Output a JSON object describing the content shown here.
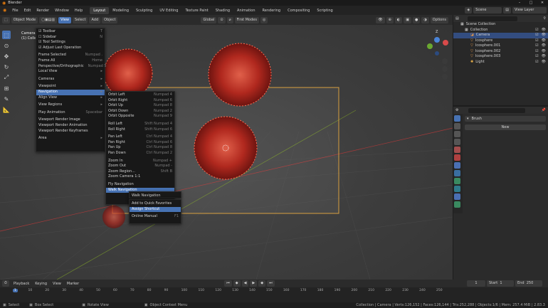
{
  "app": {
    "title": "Blender"
  },
  "menubar": {
    "items": [
      "File",
      "Edit",
      "Render",
      "Window",
      "Help"
    ],
    "workspaces": [
      "Layout",
      "Modeling",
      "Sculpting",
      "UV Editing",
      "Texture Paint",
      "Shading",
      "Animation",
      "Rendering",
      "Compositing",
      "Scripting"
    ],
    "active_workspace": "Layout",
    "scene": "Scene",
    "view_layer": "View Layer"
  },
  "header3d": {
    "mode": "Object Mode",
    "menus": [
      "View",
      "Select",
      "Add",
      "Object"
    ],
    "transform": "Global",
    "snap": "First Modes",
    "options": "Options"
  },
  "viewport": {
    "camera_label": "Camera P",
    "collection_label": "(1) Colle"
  },
  "view_menu": {
    "items": [
      {
        "label": "Toolbar",
        "shortcut": "T",
        "check": true
      },
      {
        "label": "Sidebar",
        "shortcut": "N",
        "check": false
      },
      {
        "label": "Tool Settings",
        "shortcut": "",
        "check": true
      },
      {
        "label": "Adjust Last Operation",
        "shortcut": "",
        "check": true
      },
      {
        "sep": true
      },
      {
        "label": "Frame Selected",
        "shortcut": "Numpad ."
      },
      {
        "label": "Frame All",
        "shortcut": "Home"
      },
      {
        "label": "Perspective/Orthographic",
        "shortcut": "Numpad 5"
      },
      {
        "label": "Local View",
        "shortcut": "",
        "sub": true
      },
      {
        "sep": true
      },
      {
        "label": "Cameras",
        "shortcut": "",
        "sub": true
      },
      {
        "sep": true
      },
      {
        "label": "Viewpoint",
        "shortcut": "",
        "sub": true
      },
      {
        "label": "Navigation",
        "shortcut": "",
        "sub": true,
        "hl": true
      },
      {
        "label": "Align View",
        "shortcut": "",
        "sub": true
      },
      {
        "sep": true
      },
      {
        "label": "View Regions",
        "shortcut": "",
        "sub": true
      },
      {
        "sep": true
      },
      {
        "label": "Play Animation",
        "shortcut": "Spacebar"
      },
      {
        "sep": true
      },
      {
        "label": "Viewport Render Image",
        "shortcut": ""
      },
      {
        "label": "Viewport Render Animation",
        "shortcut": ""
      },
      {
        "label": "Viewport Render Keyframes",
        "shortcut": ""
      },
      {
        "sep": true
      },
      {
        "label": "Area",
        "shortcut": "",
        "sub": true
      }
    ]
  },
  "nav_menu": {
    "items": [
      {
        "label": "Orbit Left",
        "shortcut": "Numpad 4"
      },
      {
        "label": "Orbit Right",
        "shortcut": "Numpad 6"
      },
      {
        "label": "Orbit Up",
        "shortcut": "Numpad 8"
      },
      {
        "label": "Orbit Down",
        "shortcut": "Numpad 2"
      },
      {
        "label": "Orbit Opposite",
        "shortcut": "Numpad 9"
      },
      {
        "sep": true
      },
      {
        "label": "Roll Left",
        "shortcut": "Shift Numpad 4"
      },
      {
        "label": "Roll Right",
        "shortcut": "Shift Numpad 6"
      },
      {
        "sep": true
      },
      {
        "label": "Pan Left",
        "shortcut": "Ctrl Numpad 4"
      },
      {
        "label": "Pan Right",
        "shortcut": "Ctrl Numpad 6"
      },
      {
        "label": "Pan Up",
        "shortcut": "Ctrl Numpad 8"
      },
      {
        "label": "Pan Down",
        "shortcut": "Ctrl Numpad 2"
      },
      {
        "sep": true
      },
      {
        "label": "Zoom In",
        "shortcut": "Numpad +"
      },
      {
        "label": "Zoom Out",
        "shortcut": "Numpad -"
      },
      {
        "label": "Zoom Region...",
        "shortcut": "Shift B"
      },
      {
        "label": "Zoom Camera 1:1",
        "shortcut": ""
      },
      {
        "sep": true
      },
      {
        "label": "Fly Navigation",
        "shortcut": ""
      },
      {
        "label": "Walk Navigation",
        "shortcut": "",
        "hl": true
      }
    ]
  },
  "tooltip": {
    "text": "Walk Navigation"
  },
  "context_menu": {
    "items": [
      {
        "label": "Add to Quick Favorites",
        "shortcut": ""
      },
      {
        "label": "Assign Shortcut",
        "shortcut": "",
        "hl": true
      },
      {
        "sep": true
      },
      {
        "label": "Online Manual",
        "shortcut": "F1"
      }
    ]
  },
  "outliner": {
    "root": "Scene Collection",
    "items": [
      {
        "label": "Collection",
        "indent": 1
      },
      {
        "label": "Camera",
        "indent": 2,
        "sel": true
      },
      {
        "label": "Icosphere",
        "indent": 2
      },
      {
        "label": "Icosphere.001",
        "indent": 2
      },
      {
        "label": "Icosphere.002",
        "indent": 2
      },
      {
        "label": "Icosphere.003",
        "indent": 2
      },
      {
        "label": "Light",
        "indent": 2
      }
    ]
  },
  "properties": {
    "brush": "Brush",
    "new_button": "New"
  },
  "timeline": {
    "menus": [
      "Playback",
      "Keying",
      "View",
      "Marker"
    ],
    "current_frame": "1",
    "start_label": "Start",
    "start": "1",
    "end_label": "End",
    "end": "250",
    "ticks": [
      "1",
      "10",
      "20",
      "30",
      "40",
      "50",
      "60",
      "70",
      "80",
      "90",
      "100",
      "110",
      "120",
      "130",
      "140",
      "150",
      "160",
      "170",
      "180",
      "190",
      "200",
      "210",
      "220",
      "230",
      "240",
      "250"
    ]
  },
  "statusbar": {
    "left": [
      "Select",
      "Box Select",
      "Rotate View",
      "Object Context Menu"
    ],
    "right": "Collection | Camera | Verts:126,152 | Faces:126,144 | Tris:252,288 | Objects:1/6 | Mem: 257.4 MiB | 2.83.3"
  },
  "colors": {
    "accent": "#4772b3",
    "virus": "#c0392b",
    "frame": "#d8a040"
  }
}
